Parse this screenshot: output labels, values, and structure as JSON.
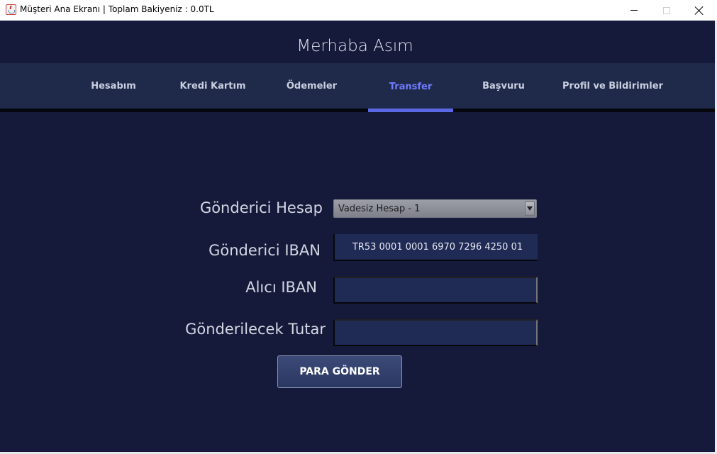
{
  "window": {
    "title": "Müşteri Ana Ekranı | Toplam Bakiyeniz : 0.0TL"
  },
  "greeting": "Merhaba Asım",
  "tabs": [
    {
      "label": "Hesabım",
      "active": false
    },
    {
      "label": "Kredi Kartım",
      "active": false
    },
    {
      "label": "Ödemeler",
      "active": false
    },
    {
      "label": "Transfer",
      "active": true
    },
    {
      "label": "Başvuru",
      "active": false
    },
    {
      "label": "Profil ve Bildirimler",
      "active": false
    }
  ],
  "form": {
    "sender_account_label": "Gönderici Hesap",
    "sender_account_value": "Vadesiz Hesap - 1",
    "sender_iban_label": "Gönderici IBAN",
    "sender_iban_value": "TR53 0001 0001 6970 7296 4250 01",
    "recipient_iban_label": "Alıcı IBAN",
    "recipient_iban_value": "",
    "amount_label": "Gönderilecek Tutar",
    "amount_value": "",
    "submit_label": "PARA GÖNDER"
  },
  "colors": {
    "background": "#161a3a",
    "tabbar": "#1f2a4b",
    "active_tab": "#6f7bff",
    "field": "#1f2a55"
  },
  "icons": {
    "app": "java-cup-icon",
    "minimize": "minimize-icon",
    "maximize": "maximize-icon",
    "close": "close-icon"
  }
}
